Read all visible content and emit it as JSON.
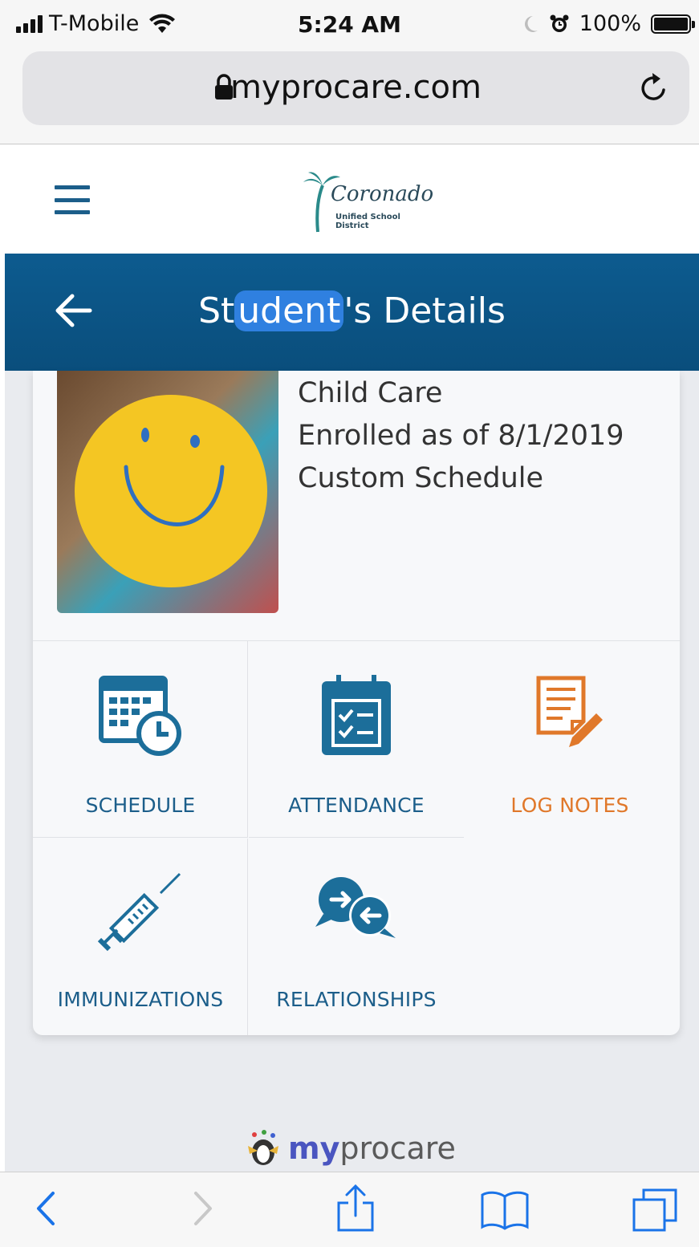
{
  "status_bar": {
    "carrier": "T-Mobile",
    "time": "5:24 AM",
    "battery": "100%"
  },
  "browser": {
    "url": "myprocare.com"
  },
  "app_header": {
    "logo_script": "Coronado",
    "logo_sub": "Unified School District"
  },
  "title_bar": {
    "title_prefix": "St",
    "title_redacted": "udent",
    "title_suffix": "'s Details"
  },
  "student": {
    "program": "Child Care",
    "enrolled": "Enrolled as of 8/1/2019",
    "schedule_type": "Custom Schedule"
  },
  "tiles": [
    {
      "label": "SCHEDULE",
      "icon": "calendar-clock-icon"
    },
    {
      "label": "ATTENDANCE",
      "icon": "attendance-checklist-icon"
    },
    {
      "label": "LOG NOTES",
      "icon": "log-notes-pencil-icon"
    },
    {
      "label": "IMMUNIZATIONS",
      "icon": "syringe-icon"
    },
    {
      "label": "RELATIONSHIPS",
      "icon": "relationships-chat-icon"
    }
  ],
  "colors": {
    "brand_blue": "#1c5e8a",
    "title_bar": "#0d5b8f",
    "log_notes_orange": "#e0782a"
  },
  "footer": {
    "brand_my": "my",
    "brand_procare": "procare"
  }
}
